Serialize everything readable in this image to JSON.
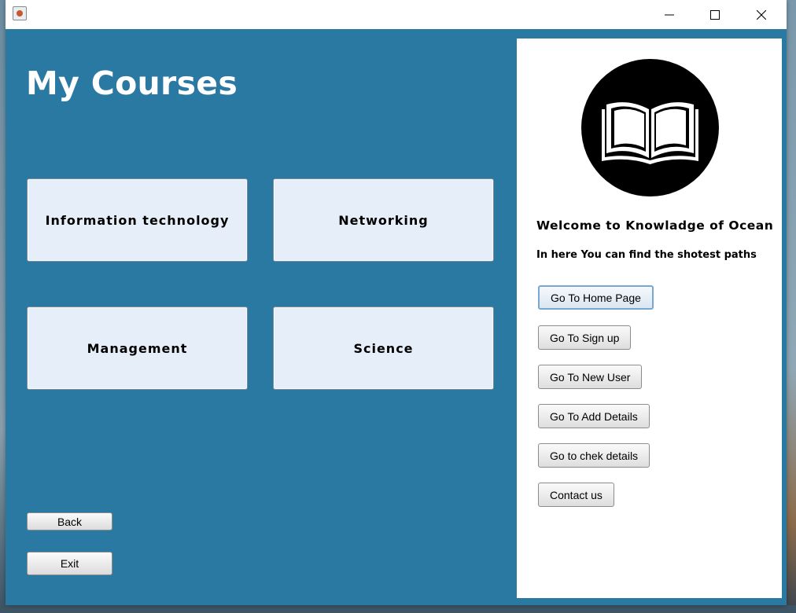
{
  "window": {
    "title_bar": {
      "minimize_icon": "minimize-icon",
      "maximize_icon": "maximize-icon",
      "close_icon": "close-icon"
    }
  },
  "main": {
    "title": "My Courses",
    "courses": [
      "Information technology",
      "Networking",
      "Management",
      "Science"
    ],
    "back_label": "Back",
    "exit_label": "Exit"
  },
  "side": {
    "logo_icon": "open-book-icon",
    "welcome": "Welcome to Knowladge of Ocean",
    "subtitle": "In here You can find the shotest paths",
    "nav": [
      "Go To Home Page",
      "Go To Sign up",
      "Go To New User",
      "Go To Add Details",
      "Go to chek details",
      "Contact us"
    ]
  },
  "colors": {
    "window_bg": "#2a79a3",
    "course_btn_bg": "#e6eef9",
    "panel_bg": "#ffffff",
    "focus_border": "#7aa7cf"
  }
}
